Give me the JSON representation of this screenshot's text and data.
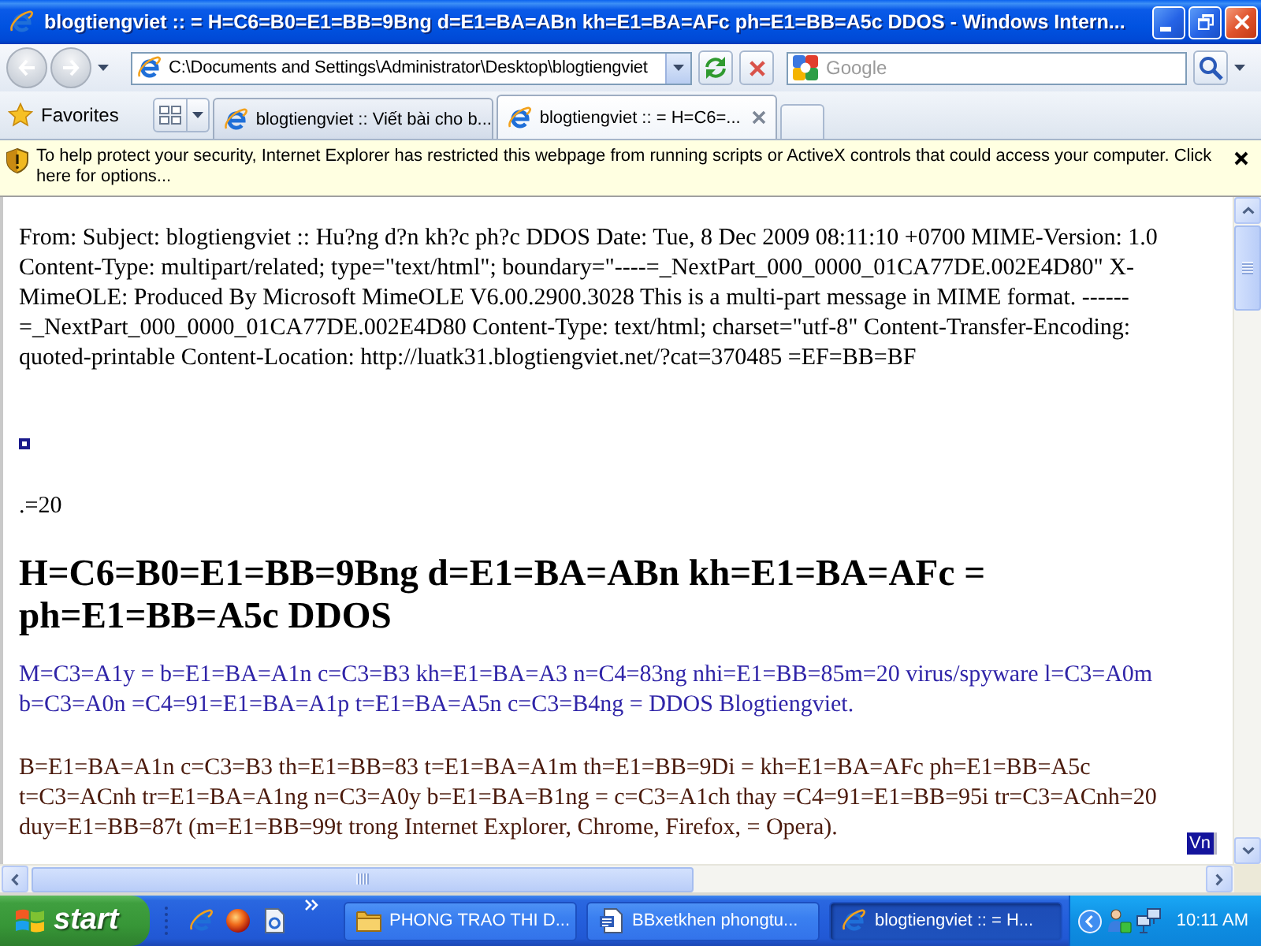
{
  "window": {
    "title": "blogtiengviet :: = H=C6=B0=E1=BB=9Bng d=E1=BA=ABn kh=E1=BA=AFc ph=E1=BB=A5c DDOS - Windows Intern..."
  },
  "nav": {
    "buttons": [
      {
        "kind": "back",
        "disabled": true
      },
      {
        "kind": "forward",
        "disabled": true
      }
    ],
    "address": "C:\\Documents and Settings\\Administrator\\Desktop\\blogtiengviet",
    "search": {
      "placeholder": "Google"
    }
  },
  "favorites": {
    "label": "Favorites"
  },
  "tabs": [
    {
      "label": "blogtiengviet :: Viết bài cho b...",
      "selected": false
    },
    {
      "label": "blogtiengviet :: = H=C6=...",
      "selected": true
    }
  ],
  "info_bar": {
    "message": "To help protect your security, Internet Explorer has restricted this webpage from running scripts or ActiveX controls that could access your computer. Click here for options..."
  },
  "page": {
    "header": "From: Subject: blogtiengviet :: Hu?ng d?n kh?c ph?c DDOS Date: Tue, 8 Dec 2009 08:11:10 +0700 MIME-Version: 1.0 Content-Type: multipart/related; type=\"text/html\"; boundary=\"----=_NextPart_000_0000_01CA77DE.002E4D80\" X-MimeOLE: Produced By Microsoft MimeOLE V6.00.2900.3028 This is a multi-part message in MIME format. ------=_NextPart_000_0000_01CA77DE.002E4D80 Content-Type: text/html; charset=\"utf-8\" Content-Transfer-Encoding: quoted-printable Content-Location: http://luatk31.blogtiengviet.net/?cat=370485 =EF=BB=BF",
    "fragment": ".=20",
    "heading": "H=C6=B0=E1=BB=9Bng d=E1=BA=ABn kh=E1=BA=AFc = ph=E1=BB=A5c DDOS",
    "paragraphs": [
      {
        "text": "M=C3=A1y = b=E1=BA=A1n c=C3=B3 kh=E1=BA=A3 n=C4=83ng nhi=E1=BB=85m=20 virus/spyware l=C3=A0m b=C3=A0n =C4=91=E1=BA=A1p t=E1=BA=A5n c=C3=B4ng = DDOS Blogtiengviet.",
        "color": "#3025a8"
      },
      {
        "text": "B=E1=BA=A1n c=C3=B3 th=E1=BB=83 t=E1=BA=A1m th=E1=BB=9Di = kh=E1=BA=AFc ph=E1=BB=A5c t=C3=ACnh tr=E1=BA=A1ng n=C3=A0y b=E1=BA=B1ng = c=C3=A1ch thay =C4=91=E1=BB=95i tr=C3=ACnh=20 duy=E1=BB=87t (m=E1=BB=99t trong Internet Explorer, Chrome, Firefox, = Opera).",
        "color": "#4b1a0c"
      }
    ],
    "indicator": "Vn"
  },
  "taskbar": {
    "start": "start",
    "buttons": [
      {
        "kind": "folder",
        "label": "PHONG TRAO THI D...",
        "selected": false
      },
      {
        "kind": "document",
        "label": "BBxetkhen phongtu...",
        "selected": false
      },
      {
        "kind": "browser",
        "label": "blogtiengviet :: = H...",
        "selected": true
      }
    ],
    "clock": "10:11 AM"
  }
}
